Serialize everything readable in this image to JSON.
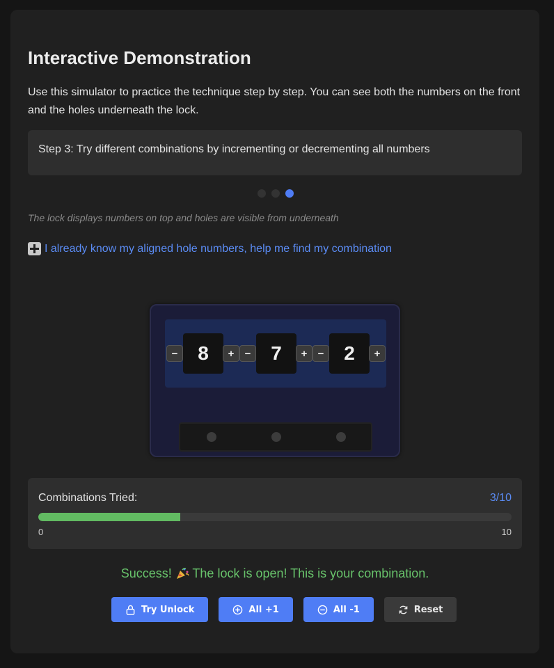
{
  "heading": "Interactive Demonstration",
  "intro": "Use this simulator to practice the technique step by step. You can see both the numbers on the front and the holes underneath the lock.",
  "step_text": "Step 3: Try different combinations by incrementing or decrementing all numbers",
  "step_dots": {
    "total": 3,
    "active": 3
  },
  "caption": "The lock displays numbers on top and holes are visible from underneath",
  "helper_link": "I already know my aligned hole numbers, help me find my combination",
  "helper_icon": "plus-square-icon",
  "lock": {
    "digits": [
      "8",
      "7",
      "2"
    ],
    "decrement_label": "−",
    "increment_label": "+"
  },
  "progress": {
    "label": "Combinations Tried:",
    "count": "3/10",
    "value": 3,
    "max": 10,
    "min_label": "0",
    "max_label": "10"
  },
  "success_before": "Success! ",
  "success_after": " The lock is open! This is your combination.",
  "success_icon": "party-popper-icon",
  "buttons": {
    "try_unlock": "Try Unlock",
    "all_plus": "All +1",
    "all_minus": "All -1",
    "reset": "Reset"
  },
  "colors": {
    "accent": "#4f7df5",
    "success": "#68c36b",
    "progress_fill": "#62bb62",
    "background": "#202020"
  }
}
